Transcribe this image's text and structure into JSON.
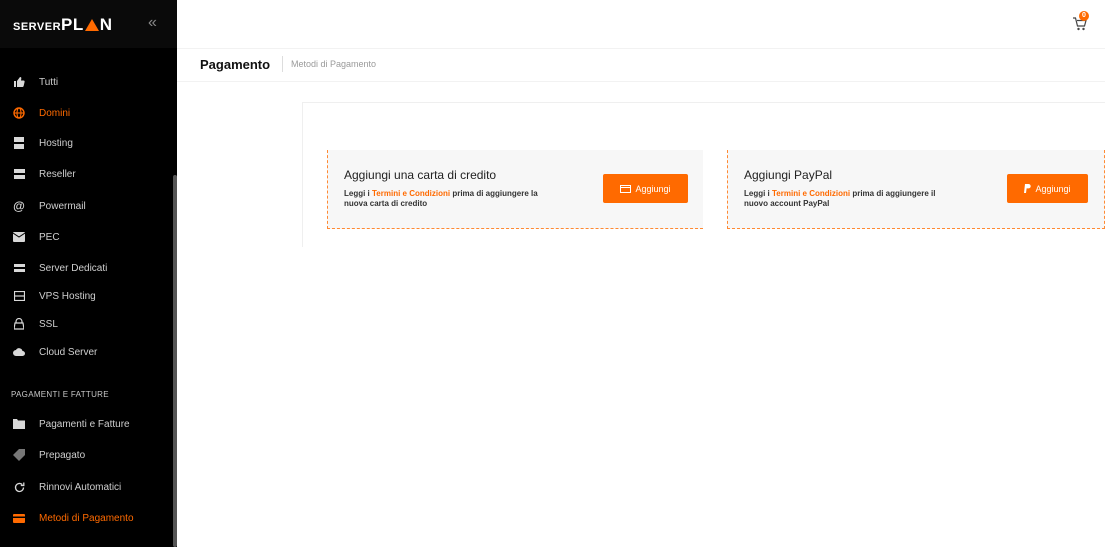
{
  "brand": {
    "prefix": "SERVER",
    "main_left": "PL",
    "main_right": "N",
    "collapse_label": "«"
  },
  "sidebar": {
    "items": [
      {
        "label": "Tutti",
        "icon": "thumbs-up-icon"
      },
      {
        "label": "Domini",
        "icon": "globe-icon",
        "active": true
      },
      {
        "label": "Hosting",
        "icon": "hosting-icon"
      },
      {
        "label": "Reseller",
        "icon": "reseller-icon"
      },
      {
        "label": "Powermail",
        "icon": "at-icon"
      },
      {
        "label": "PEC",
        "icon": "envelope-icon"
      },
      {
        "label": "Server Dedicati",
        "icon": "server-icon"
      },
      {
        "label": "VPS Hosting",
        "icon": "vps-icon"
      },
      {
        "label": "SSL",
        "icon": "lock-icon"
      },
      {
        "label": "Cloud Server",
        "icon": "cloud-icon"
      },
      {
        "label": "Pagamenti e Fatture",
        "icon": "folder-icon"
      },
      {
        "label": "Prepagato",
        "icon": "tag-icon"
      },
      {
        "label": "Rinnovi Automatici",
        "icon": "refresh-icon"
      },
      {
        "label": "Metodi di Pagamento",
        "icon": "credit-card-icon",
        "active": true
      }
    ],
    "section_title": "PAGAMENTI E FATTURE"
  },
  "header": {
    "cart_count": "0"
  },
  "breadcrumb": {
    "title": "Pagamento",
    "current": "Metodi di Pagamento"
  },
  "cards": [
    {
      "title": "Aggiungi una carta di credito",
      "desc_pre": "Leggi i ",
      "desc_link1": "Termini",
      "desc_and": " e ",
      "desc_link2": "Condizioni",
      "desc_post": " prima di aggiungere la nuova carta di credito",
      "button": "Aggiungi",
      "button_icon": "credit-card-icon"
    },
    {
      "title": "Aggiungi PayPal",
      "desc_pre": "Leggi i ",
      "desc_link1": "Termini",
      "desc_and": " e ",
      "desc_link2": "Condizioni",
      "desc_post": " prima di aggiungere il nuovo account PayPal",
      "button": "Aggiungi",
      "button_icon": "paypal-icon"
    }
  ],
  "colors": {
    "accent": "#ff6a00",
    "sidebar_bg": "#000000"
  }
}
